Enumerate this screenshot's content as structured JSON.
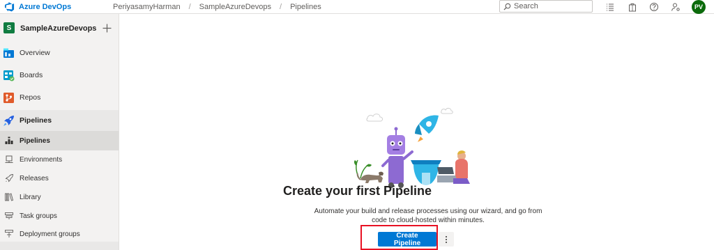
{
  "app": {
    "title": "Azure DevOps"
  },
  "breadcrumb": [
    {
      "label": "PeriyasamyHarman"
    },
    {
      "label": "SampleAzureDevops"
    },
    {
      "label": "Pipelines"
    }
  ],
  "breadcrumb_separator": "/",
  "search": {
    "placeholder": "Search",
    "value": ""
  },
  "user": {
    "initials": "PV"
  },
  "project": {
    "initial": "S",
    "name": "SampleAzureDevops",
    "add_icon": "plus-icon"
  },
  "sidebar": {
    "items": [
      {
        "label": "Overview",
        "icon": "overview-icon"
      },
      {
        "label": "Boards",
        "icon": "boards-icon"
      },
      {
        "label": "Repos",
        "icon": "repos-icon"
      },
      {
        "label": "Pipelines",
        "icon": "pipelines-icon",
        "active": true
      }
    ],
    "subitems": [
      {
        "label": "Pipelines",
        "icon": "pipelines-sub-icon",
        "active": true
      },
      {
        "label": "Environments",
        "icon": "environments-icon"
      },
      {
        "label": "Releases",
        "icon": "rocket-icon"
      },
      {
        "label": "Library",
        "icon": "library-icon"
      },
      {
        "label": "Task groups",
        "icon": "task-groups-icon"
      },
      {
        "label": "Deployment groups",
        "icon": "deployment-groups-icon"
      }
    ]
  },
  "empty_state": {
    "title": "Create your first Pipeline",
    "description": "Automate your build and release processes using our wizard, and go from code to cloud-hosted within minutes.",
    "primary_button": "Create Pipeline",
    "more_icon": "more-vertical-icon"
  },
  "colors": {
    "accent": "#0078d4",
    "highlight_frame": "#e81123",
    "avatar_bg": "#0b6a0b",
    "project_badge": "#107c41"
  }
}
